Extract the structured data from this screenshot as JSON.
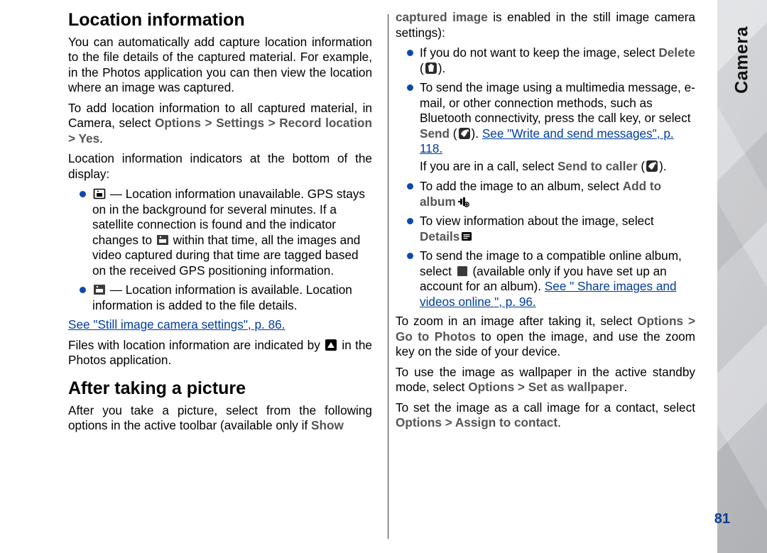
{
  "sidebar": {
    "chapter": "Camera"
  },
  "page_number": "81",
  "left": {
    "h1": "Location information",
    "p1": "You can automatically add capture location information to the file details of the captured material. For example, in the Photos application you can then view the location where an image was captured.",
    "p2a": "To add location information to all captured material, in Camera, select ",
    "p2_opt": "Options",
    "p2_gt1": " > ",
    "p2_set": "Settings",
    "p2_gt2": " > ",
    "p2_rec": "Record location",
    "p2_gt3": " > ",
    "p2_yes": "Yes",
    "p2_end": ".",
    "p3": "Location information indicators at the bottom of the display:",
    "bul1a": " — Location information unavailable. GPS stays on in the background for several minutes. If a satellite connection is found and the indicator changes to ",
    "bul1b": " within that time, all the images and video captured during that time are tagged based on the received GPS positioning information.",
    "bul2": " — Location information is available. Location information is added to the file details.",
    "link1": "See \"Still image camera settings\", p. 86.",
    "p4a": "Files with location information are indicated by ",
    "p4b": " in the Photos application.",
    "h2": "After taking a picture",
    "p5a": "After you take a picture, select from the following options in the active toolbar (available only if ",
    "p5b": "Show"
  },
  "right": {
    "p1a": "captured image",
    "p1b": " is enabled in the still image camera settings):",
    "bul1a": "If you do not want to keep the image, select ",
    "bul1_del": "Delete",
    "bul1b": " (",
    "bul1c": ").",
    "bul2a": "To send the image using a multimedia message, e-mail, or other connection methods, such as Bluetooth connectivity, press the call key, or select ",
    "bul2_send": "Send",
    "bul2b": " (",
    "bul2c": "). ",
    "bul2_link": "See \"Write and send messages\", p. 118.",
    "bul2_sub_a": "If you are in a call, select ",
    "bul2_sub_b": "Send to caller",
    "bul2_sub_c": " (",
    "bul2_sub_d": ").",
    "bul3a": "To add the image to an album, select ",
    "bul3b": "Add to album",
    "bul4a": "To view information about the image, select ",
    "bul4b": "Details",
    "bul5a": "To send the image to a compatible online album, select ",
    "bul5b": " (available only if you have set up an account for an album). ",
    "bul5_link": "See \" Share images and videos online \", p. 96.",
    "p2a": "To zoom in an image after taking it, select ",
    "p2_opt": "Options",
    "p2_gt": " > ",
    "p2_go": "Go to Photos",
    "p2b": " to open the image, and use the zoom key on the side of your device.",
    "p3a": "To use the image as wallpaper in the active standby mode, select ",
    "p3_opt": "Options",
    "p3_gt": " > ",
    "p3_wall": "Set as wallpaper",
    "p3b": ".",
    "p4a": "To set the image as a call image for a contact, select ",
    "p4_opt": "Options",
    "p4_gt": " > ",
    "p4_assign": "Assign to contact",
    "p4b": "."
  }
}
